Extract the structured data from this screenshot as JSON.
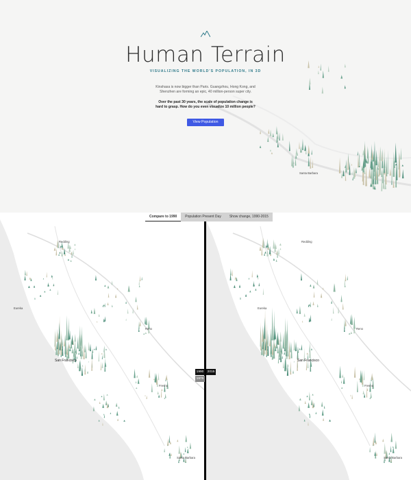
{
  "hero": {
    "title": "Human Terrain",
    "subtitle": "VISUALIZING THE WORLD'S POPULATION, IN 3D",
    "intro": "Kinshasa is now bigger than Paris. Guangzhou, Hong Kong, and Shenzhen are forming an epic, 40 million-person super city.",
    "intro_bold": "Over the past 30 years, the scale of population change is hard to grasp. How do you even visualize 10 million people?",
    "cta_label": "View Population",
    "hero_city": "Santa Barbara"
  },
  "compare": {
    "tabs": [
      {
        "label": "Compare to 1990",
        "active": true
      },
      {
        "label": "Population Present Day",
        "active": false
      },
      {
        "label": "Show change, 1990-2015",
        "active": false
      }
    ],
    "year_left": "1990",
    "year_right": "2015",
    "year_start": "1975"
  },
  "map_labels": {
    "left": [
      {
        "name": "Redding"
      },
      {
        "name": "Eureka"
      },
      {
        "name": "Reno"
      },
      {
        "name": "Fresno"
      },
      {
        "name": "San Francisco"
      },
      {
        "name": "Santa Barbara"
      }
    ],
    "right": [
      {
        "name": "Redding"
      },
      {
        "name": "Eureka"
      },
      {
        "name": "Reno"
      },
      {
        "name": "Fresno"
      },
      {
        "name": "San Francisco"
      },
      {
        "name": "Santa Barbara"
      }
    ]
  },
  "colors": {
    "accent": "#3f59e4",
    "subtitle": "#2f7a8a",
    "terrain": "#4f8f7b",
    "divider": "#000000"
  }
}
